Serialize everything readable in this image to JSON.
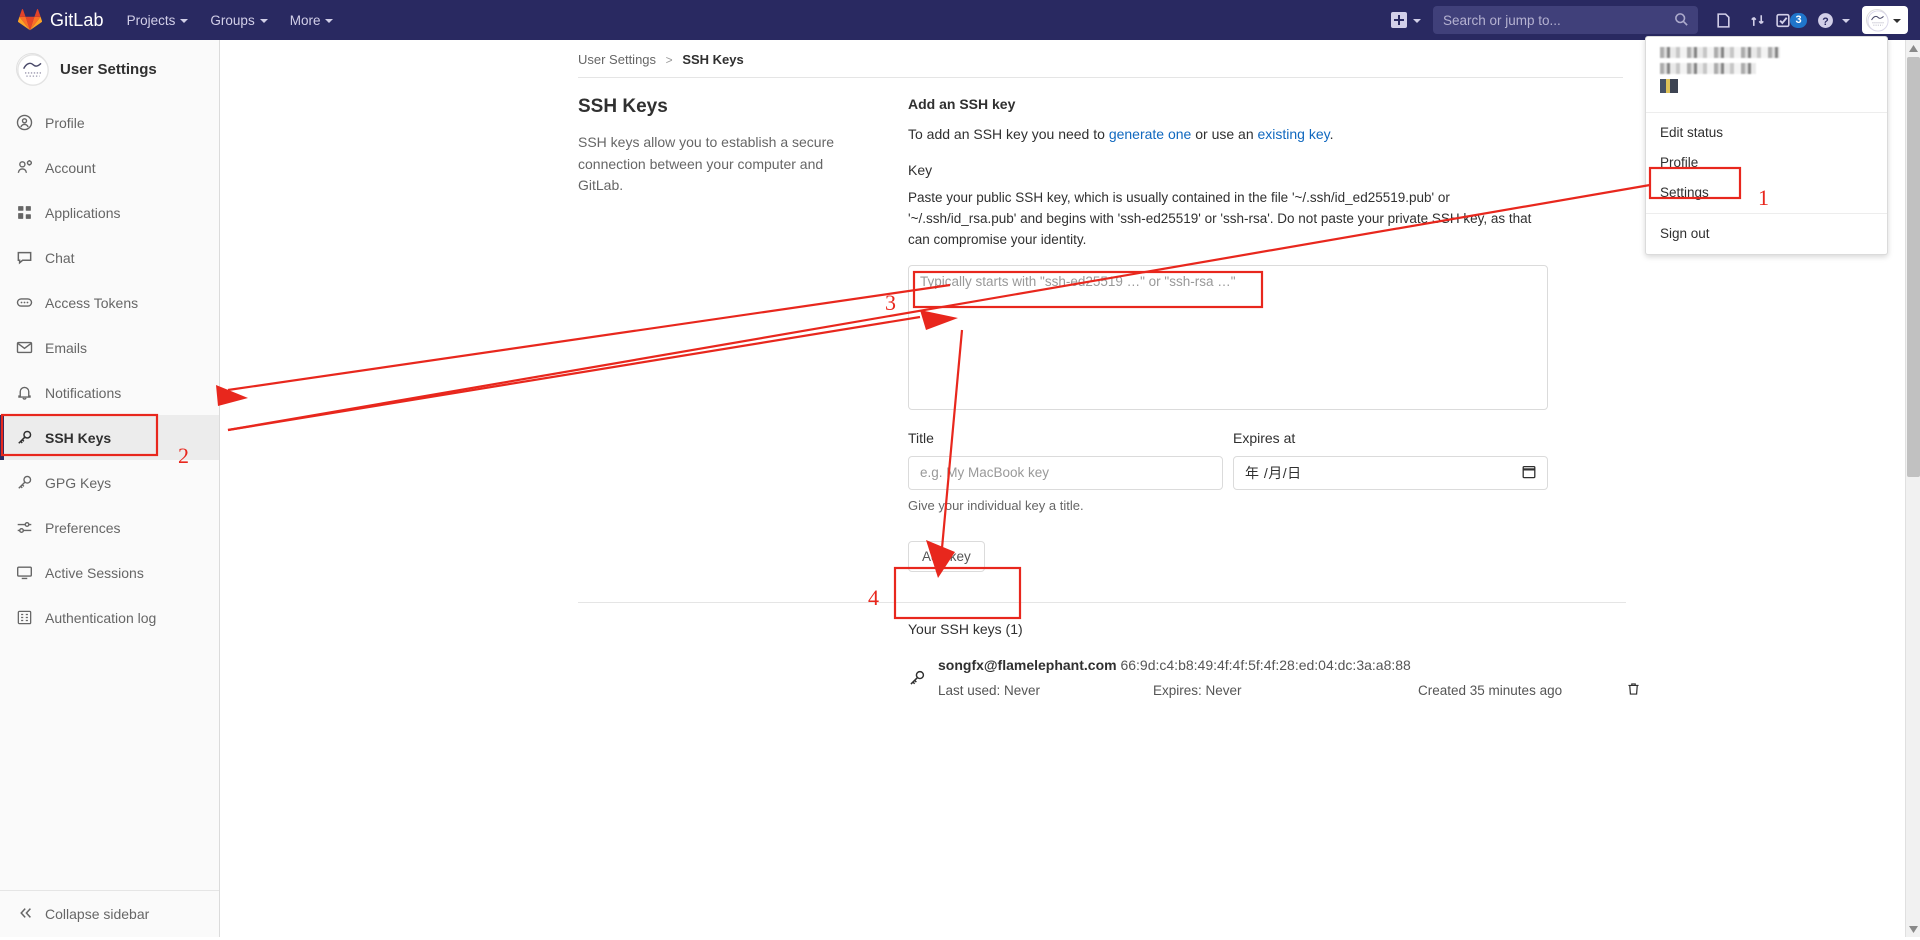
{
  "navbar": {
    "brand": "GitLab",
    "brand_icon": "gitlab-tanuki-icon",
    "links": [
      {
        "label": "Projects",
        "icon": "chevron-down-icon"
      },
      {
        "label": "Groups",
        "icon": "chevron-down-icon"
      },
      {
        "label": "More",
        "icon": "chevron-down-icon"
      }
    ],
    "create_new_icon": "plus-square-icon",
    "search": {
      "placeholder": "Search or jump to...",
      "value": "",
      "icon": "search-icon"
    },
    "icons": [
      {
        "name": "issues-icon",
        "title": "Issues"
      },
      {
        "name": "merge-requests-icon",
        "title": "Merge requests"
      },
      {
        "name": "todos-icon",
        "title": "To-Do list",
        "badge": "3"
      },
      {
        "name": "help-icon",
        "title": "Help"
      }
    ],
    "avatar_icon": "user-avatar-icon"
  },
  "user_dropdown": {
    "items_group_1": [
      {
        "label": "Edit status",
        "name": "edit-status"
      },
      {
        "label": "Profile",
        "name": "profile",
        "highlighted": true
      },
      {
        "label": "Settings",
        "name": "settings"
      }
    ],
    "items_group_2": [
      {
        "label": "Sign out",
        "name": "sign-out"
      }
    ]
  },
  "sidebar": {
    "title": "User Settings",
    "items": [
      {
        "label": "Profile",
        "icon": "user-circle-icon",
        "active": false
      },
      {
        "label": "Account",
        "icon": "account-gear-icon",
        "active": false
      },
      {
        "label": "Applications",
        "icon": "applications-grid-icon",
        "active": false
      },
      {
        "label": "Chat",
        "icon": "chat-bubble-icon",
        "active": false
      },
      {
        "label": "Access Tokens",
        "icon": "token-icon",
        "active": false
      },
      {
        "label": "Emails",
        "icon": "envelope-icon",
        "active": false
      },
      {
        "label": "Notifications",
        "icon": "bell-icon",
        "active": false
      },
      {
        "label": "SSH Keys",
        "icon": "key-icon",
        "active": true
      },
      {
        "label": "GPG Keys",
        "icon": "key-icon",
        "active": false
      },
      {
        "label": "Preferences",
        "icon": "sliders-icon",
        "active": false
      },
      {
        "label": "Active Sessions",
        "icon": "monitor-icon",
        "active": false
      },
      {
        "label": "Authentication log",
        "icon": "log-list-icon",
        "active": false
      }
    ],
    "collapse": {
      "label": "Collapse sidebar",
      "icon": "double-chevron-left-icon"
    }
  },
  "breadcrumb": {
    "root": "User Settings",
    "separator": ">",
    "current": "SSH Keys"
  },
  "settings": {
    "section_title": "SSH Keys",
    "section_desc": "SSH keys allow you to establish a secure connection between your computer and GitLab.",
    "add_title": "Add an SSH key",
    "add_sub_pre": "To add an SSH key you need to ",
    "add_sub_link1": "generate one",
    "add_sub_mid": " or use an ",
    "add_sub_link2": "existing key",
    "add_sub_post": ".",
    "key_label": "Key",
    "key_desc": "Paste your public SSH key, which is usually contained in the file '~/.ssh/id_ed25519.pub' or '~/.ssh/id_rsa.pub' and begins with 'ssh-ed25519' or 'ssh-rsa'. Do not paste your private SSH key, as that can compromise your identity.",
    "key_placeholder": "Typically starts with \"ssh-ed25519 …\" or \"ssh-rsa …\"",
    "key_value": "",
    "title_label": "Title",
    "title_placeholder": "e.g. My MacBook key",
    "title_value": "",
    "title_hint": "Give your individual key a title.",
    "expires_label": "Expires at",
    "expires_placeholder": "年 /月/日",
    "expires_icon": "calendar-icon",
    "add_key_button": "Add key"
  },
  "keys_list": {
    "heading": "Your SSH keys (1)",
    "rows": [
      {
        "icon": "key-icon",
        "name": "songfx@flamelephant.com",
        "fingerprint": "66:9d:c4:b8:49:4f:4f:5f:4f:28:ed:04:dc:3a:a8:88",
        "last_used": "Last used: Never",
        "expires": "Expires: Never",
        "created": "Created 35 minutes ago",
        "delete_icon": "trash-icon"
      }
    ]
  },
  "annotations": {
    "color": "#e8271d",
    "markers": [
      {
        "number": "1",
        "target": "profile-menu-item"
      },
      {
        "number": "2",
        "target": "sidebar-item-ssh-keys"
      },
      {
        "number": "3",
        "target": "ssh-key-textarea"
      },
      {
        "number": "4",
        "target": "add-key-button"
      }
    ]
  }
}
